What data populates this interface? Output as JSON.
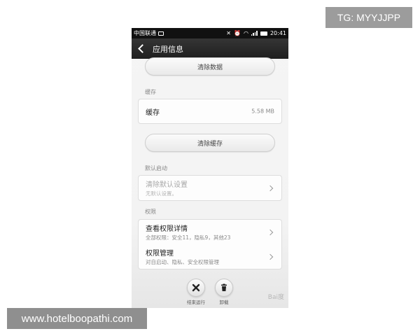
{
  "overlay": {
    "tg_text": "TG: MYYJJPP",
    "site_text": "www.hotelboopathi.com"
  },
  "status_bar": {
    "carrier": "中国联通",
    "time": "20:41"
  },
  "header": {
    "title": "应用信息"
  },
  "storage": {
    "clear_data_label": "清除数据"
  },
  "cache": {
    "section_label": "缓存",
    "row_title": "缓存",
    "row_value": "5.58 MB",
    "clear_cache_label": "清除缓存"
  },
  "default_launch": {
    "section_label": "默认启动",
    "row_title": "清除默认设置",
    "row_sub": "无默认设置。"
  },
  "permissions": {
    "section_label": "权限",
    "details_title": "查看权限详情",
    "details_sub": "全部权限：安全11，隐私9，其他23",
    "manage_title": "权限管理",
    "manage_sub": "对自启动、隐私、安全权限管理"
  },
  "actions": {
    "stop_label": "结束运行",
    "uninstall_label": "卸载"
  },
  "watermark": {
    "logo_text": "Bai度"
  },
  "icons": {
    "back": "chevron-left-icon",
    "stop": "close-x-icon",
    "uninstall": "trash-icon"
  }
}
